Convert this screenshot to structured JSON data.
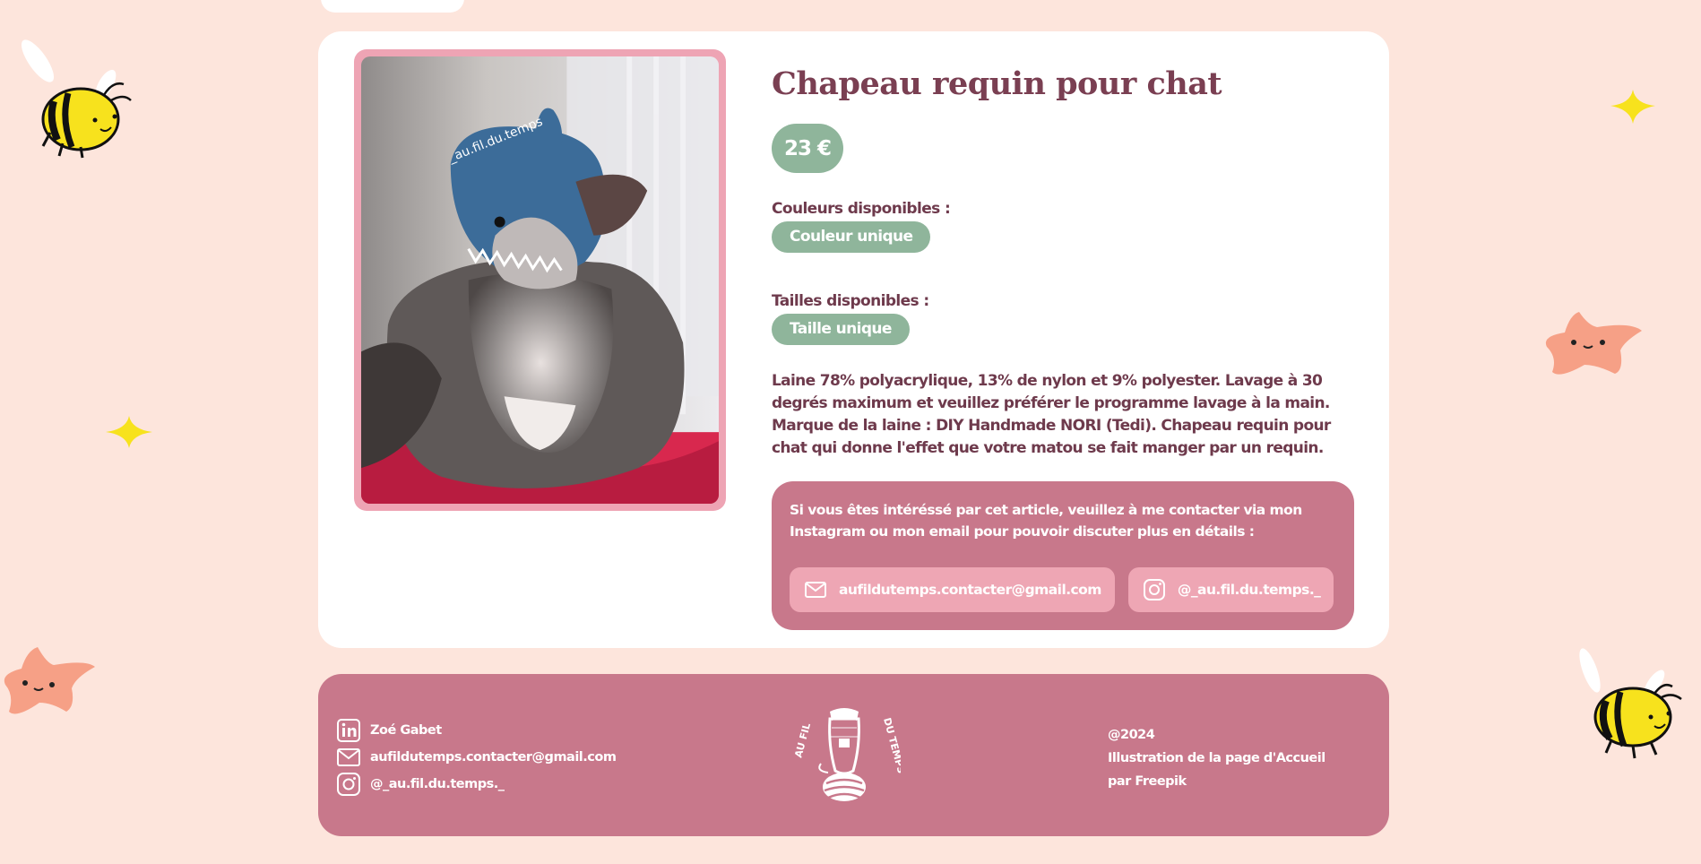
{
  "product": {
    "title": "Chapeau requin pour chat",
    "price": "23 €",
    "photo_watermark": "_au.fil.du.temps",
    "colors_label": "Couleurs disponibles :",
    "color_value": "Couleur unique",
    "sizes_label": "Tailles disponibles :",
    "size_value": "Taille unique",
    "description": "Laine 78% polyacrylique, 13% de nylon et 9% polyester. Lavage à 30 degrés maximum et veuillez préférer le programme lavage à la main. Marque de la laine : DIY Handmade NORI (Tedi). Chapeau requin pour chat qui donne l'effet que votre matou se fait manger par un requin."
  },
  "contact": {
    "text": "Si vous êtes intéréssé par cet article, veuillez à me contacter via mon Instagram ou mon email pour pouvoir discuter plus en détails :",
    "email": "aufildutemps.contacter@gmail.com",
    "instagram": "@_au.fil.du.temps._"
  },
  "footer": {
    "name": "Zoé Gabet",
    "email": "aufildutemps.contacter@gmail.com",
    "instagram": "@_au.fil.du.temps._",
    "logo_left": "AU FIL",
    "logo_right": "DU TEMPS",
    "copyright": "@2024",
    "credit_line1": "Illustration de la page d'Accueil",
    "credit_line2": "par Freepik"
  },
  "colors": {
    "background": "#fde5dc",
    "card": "#ffffff",
    "accent_pink": "#c8788b",
    "light_pink": "#eea6b4",
    "sage_green": "#8fb59b",
    "title_color": "#7a3f52"
  },
  "icons": [
    "linkedin-icon",
    "mail-icon",
    "instagram-icon",
    "bee-icon",
    "star-icon",
    "sparkle-icon"
  ]
}
